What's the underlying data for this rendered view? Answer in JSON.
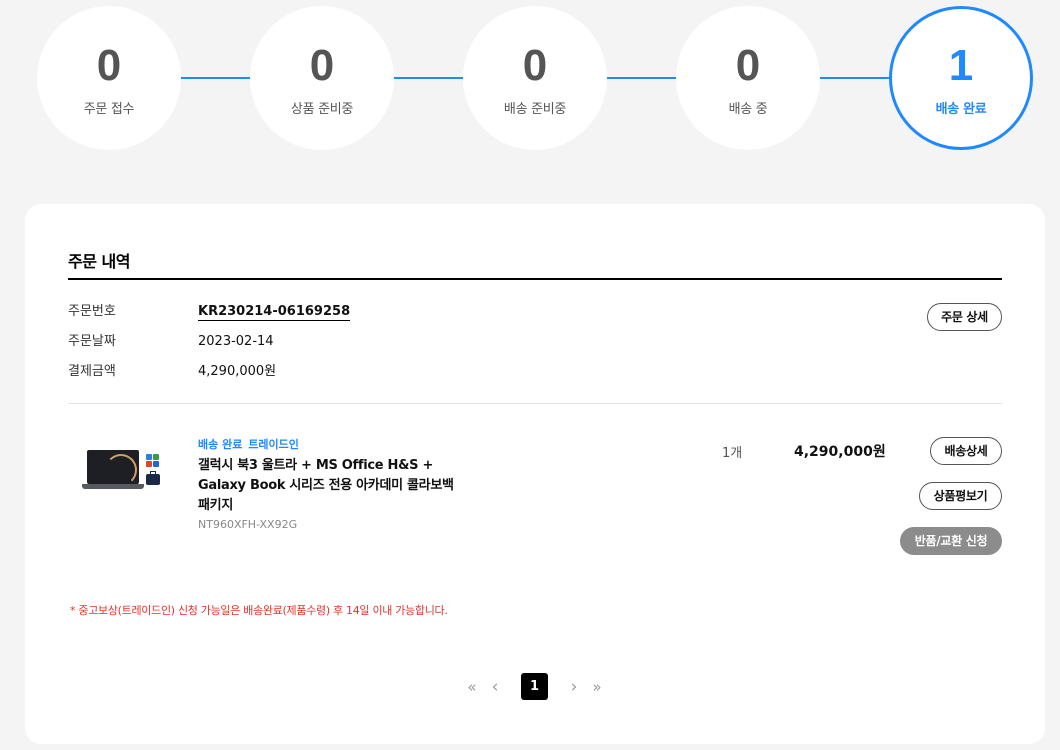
{
  "steps": [
    {
      "count": "0",
      "label": "주문 접수"
    },
    {
      "count": "0",
      "label": "상품 준비중"
    },
    {
      "count": "0",
      "label": "배송 준비중"
    },
    {
      "count": "0",
      "label": "배송 중"
    },
    {
      "count": "1",
      "label": "배송 완료"
    }
  ],
  "order": {
    "title": "주문 내역",
    "number_label": "주문번호",
    "number": "KR230214-06169258",
    "date_label": "주문날짜",
    "date": "2023-02-14",
    "amount_label": "결제금액",
    "amount": "4,290,000원",
    "detail_button": "주문 상세"
  },
  "product": {
    "badge_status": "배송 완료",
    "badge_tradein": "트레이드인",
    "name": "갤럭시 북3 울트라 + MS Office H&S + Galaxy Book 시리즈 전용 아카데미 콜라보백 패키지",
    "code": "NT960XFH-XX92G",
    "qty": "1개",
    "price": "4,290,000원",
    "btn_shipping": "배송상세",
    "btn_review": "상품평보기",
    "btn_return": "반품/교환 신청"
  },
  "notice": "* 중고보상(트레이드인) 신청 가능일은 배송완료(제품수령) 후 14일 이내 가능합니다.",
  "pagination": {
    "first": "«",
    "prev": "‹",
    "current": "1",
    "next": "›",
    "last": "»"
  },
  "colors": {
    "accent": "#2189ff",
    "notice": "#e0342c"
  }
}
